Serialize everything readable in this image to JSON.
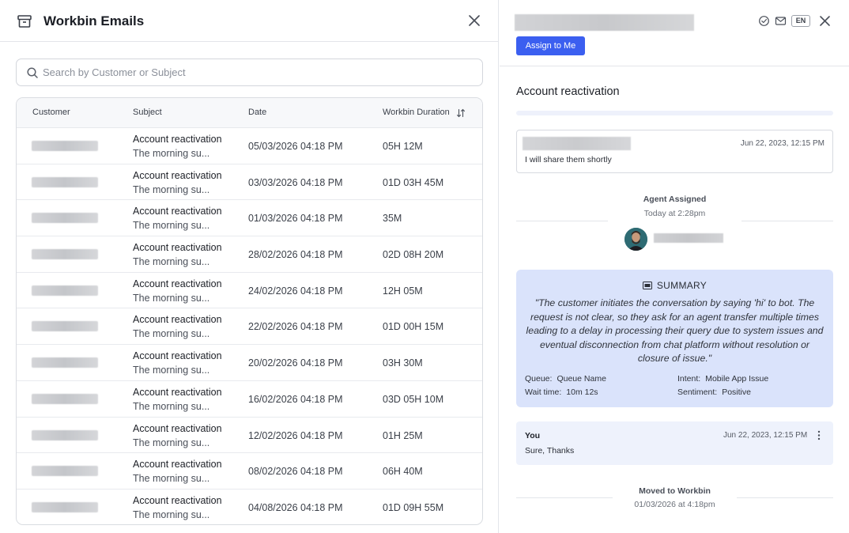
{
  "left_panel": {
    "title": "Workbin Emails",
    "search_placeholder": "Search by Customer or Subject",
    "columns": {
      "customer": "Customer",
      "subject": "Subject",
      "date": "Date",
      "duration": "Workbin Duration"
    },
    "rows": [
      {
        "subject": "Account reactivation",
        "preview": "The morning su...",
        "date": "05/03/2026 04:18 PM",
        "duration": "05H 12M"
      },
      {
        "subject": "Account reactivation",
        "preview": "The morning su...",
        "date": "03/03/2026 04:18 PM",
        "duration": "01D 03H 45M"
      },
      {
        "subject": "Account reactivation",
        "preview": "The morning su...",
        "date": "01/03/2026 04:18 PM",
        "duration": "35M"
      },
      {
        "subject": "Account reactivation",
        "preview": "The morning su...",
        "date": "28/02/2026 04:18 PM",
        "duration": "02D 08H 20M"
      },
      {
        "subject": "Account reactivation",
        "preview": "The morning su...",
        "date": "24/02/2026 04:18 PM",
        "duration": "12H 05M"
      },
      {
        "subject": "Account reactivation",
        "preview": "The morning su...",
        "date": "22/02/2026 04:18 PM",
        "duration": "01D 00H 15M"
      },
      {
        "subject": "Account reactivation",
        "preview": "The morning su...",
        "date": "20/02/2026 04:18 PM",
        "duration": "03H 30M"
      },
      {
        "subject": "Account reactivation",
        "preview": "The morning su...",
        "date": "16/02/2026 04:18 PM",
        "duration": "03D 05H 10M"
      },
      {
        "subject": "Account reactivation",
        "preview": "The morning su...",
        "date": "12/02/2026 04:18 PM",
        "duration": "01H 25M"
      },
      {
        "subject": "Account reactivation",
        "preview": "The morning su...",
        "date": "08/02/2026 04:18 PM",
        "duration": "06H 40M"
      },
      {
        "subject": "Account reactivation",
        "preview": "The morning su...",
        "date": "04/08/2026 04:18 PM",
        "duration": "01D 09H 55M"
      }
    ]
  },
  "right_panel": {
    "assign_label": "Assign to Me",
    "language": "EN",
    "conversation_title": "Account reactivation",
    "customer_message": {
      "time": "Jun 22, 2023, 12:15 PM",
      "text": "I will share them shortly"
    },
    "agent_assigned": {
      "title": "Agent Assigned",
      "time": "Today at 2:28pm"
    },
    "summary": {
      "heading": "SUMMARY",
      "text": "\"The customer initiates the conversation by saying 'hi' to bot. The request is not clear, so they ask for an agent transfer multiple times leading to a delay in processing their query due to system issues and eventual disconnection from chat platform without resolution or closure of issue.\"",
      "queue_label": "Queue:",
      "queue_value": "Queue Name",
      "intent_label": "Intent:",
      "intent_value": "Mobile App Issue",
      "wait_label": "Wait time:",
      "wait_value": "10m 12s",
      "sentiment_label": "Sentiment:",
      "sentiment_value": "Positive"
    },
    "agent_message": {
      "sender": "You",
      "time": "Jun 22, 2023, 12:15 PM",
      "text": "Sure, Thanks"
    },
    "moved": {
      "title": "Moved to Workbin",
      "time": "01/03/2026 at 4:18pm"
    }
  },
  "colors": {
    "accent": "#3b5ff0",
    "summary_bg": "#dae3fb",
    "agent_msg_bg": "#eef2fc"
  }
}
